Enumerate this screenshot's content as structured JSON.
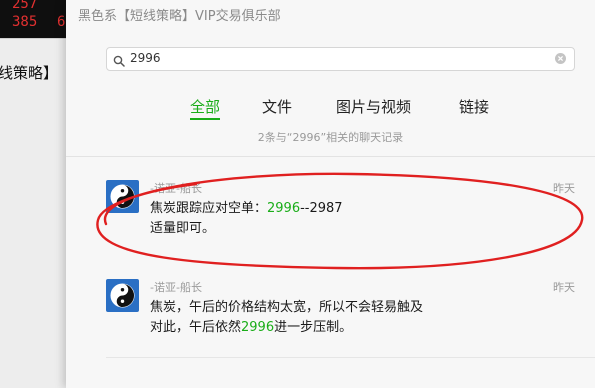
{
  "background_app": {
    "ticker_values": [
      {
        "row1": "257",
        "row2": "385",
        "row2b": "6"
      }
    ],
    "title_fragment": "线策略】"
  },
  "panel": {
    "title": "黑色系【短线策略】VIP交易俱乐部"
  },
  "search": {
    "value": "2996"
  },
  "tabs": [
    {
      "label": "全部",
      "active": true
    },
    {
      "label": "文件",
      "active": false
    },
    {
      "label": "图片与视频",
      "active": false
    },
    {
      "label": "链接",
      "active": false
    }
  ],
  "result_count": "2条与“2996”相关的聊天记录",
  "results": [
    {
      "sender": "-诺亚-船长",
      "time": "昨天",
      "line1_pre": "焦炭跟踪应对空单：",
      "line1_hl": "2996",
      "line1_post": "--2987",
      "line2_pre": "适量即可。",
      "line2_hl": "",
      "line2_post": ""
    },
    {
      "sender": "-诺亚-船长",
      "time": "昨天",
      "line1_pre": "焦炭，午后的价格结构太宽，所以不会轻易触及",
      "line1_hl": "",
      "line1_post": "",
      "line2_pre": "对此，午后依然",
      "line2_hl": "2996",
      "line2_post": "进一步压制。"
    }
  ],
  "colors": {
    "accent": "#1aad19",
    "annotation": "#e02020",
    "avatar_bg": "#2a6fc4"
  },
  "icons": {
    "search": "search-icon",
    "clear": "clear-icon",
    "avatar": "yin-yang-icon"
  }
}
